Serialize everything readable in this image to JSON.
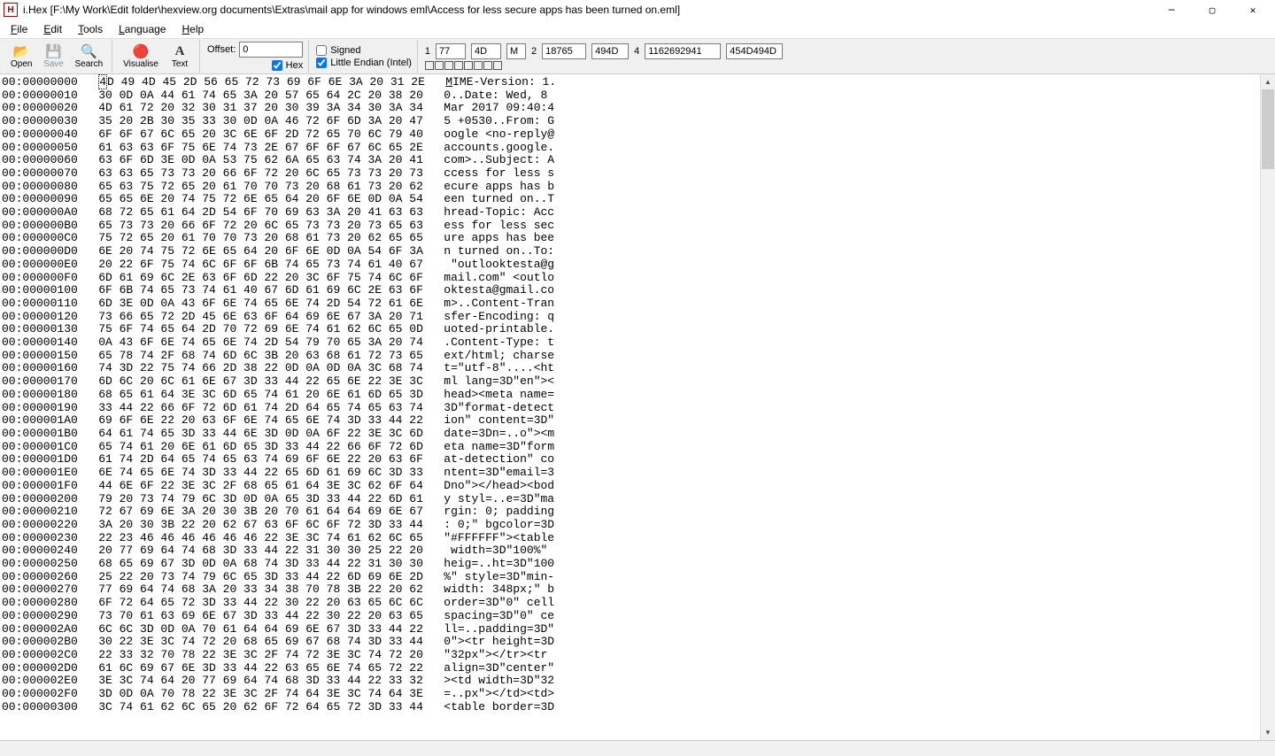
{
  "title": "i.Hex [F:\\My Work\\Edit folder\\hexview.org documents\\Extras\\mail app for windows eml\\Access for less secure apps has been turned on.eml]",
  "app_icon": "H",
  "menu": {
    "file": "File",
    "edit": "Edit",
    "tools": "Tools",
    "language": "Language",
    "help": "Help"
  },
  "toolbar": {
    "open": "Open",
    "save": "Save",
    "search": "Search",
    "visualise": "Visualise",
    "text": "Text",
    "offset_label": "Offset:",
    "offset_value": "0",
    "hex_label": "Hex",
    "signed": "Signed",
    "little_endian": "Little Endian (Intel)",
    "v1_label": "1",
    "v1a": "77",
    "v1b": "4D",
    "v1c": "M",
    "v2_label": "2",
    "v2a": "18765",
    "v2b": "494D",
    "v4_label": "4",
    "v4a": "1162692941",
    "v4b": "454D494D"
  },
  "hex_rows": [
    {
      "o": "00:00000000",
      "h": "4D 49 4D 45 2D 56 65 72 73 69 6F 6E 3A 20 31 2E",
      "a": "MIME-Version: 1."
    },
    {
      "o": "00:00000010",
      "h": "30 0D 0A 44 61 74 65 3A 20 57 65 64 2C 20 38 20",
      "a": "0..Date: Wed, 8 "
    },
    {
      "o": "00:00000020",
      "h": "4D 61 72 20 32 30 31 37 20 30 39 3A 34 30 3A 34",
      "a": "Mar 2017 09:40:4"
    },
    {
      "o": "00:00000030",
      "h": "35 20 2B 30 35 33 30 0D 0A 46 72 6F 6D 3A 20 47",
      "a": "5 +0530..From: G"
    },
    {
      "o": "00:00000040",
      "h": "6F 6F 67 6C 65 20 3C 6E 6F 2D 72 65 70 6C 79 40",
      "a": "oogle <no-reply@"
    },
    {
      "o": "00:00000050",
      "h": "61 63 63 6F 75 6E 74 73 2E 67 6F 6F 67 6C 65 2E",
      "a": "accounts.google."
    },
    {
      "o": "00:00000060",
      "h": "63 6F 6D 3E 0D 0A 53 75 62 6A 65 63 74 3A 20 41",
      "a": "com>..Subject: A"
    },
    {
      "o": "00:00000070",
      "h": "63 63 65 73 73 20 66 6F 72 20 6C 65 73 73 20 73",
      "a": "ccess for less s"
    },
    {
      "o": "00:00000080",
      "h": "65 63 75 72 65 20 61 70 70 73 20 68 61 73 20 62",
      "a": "ecure apps has b"
    },
    {
      "o": "00:00000090",
      "h": "65 65 6E 20 74 75 72 6E 65 64 20 6F 6E 0D 0A 54",
      "a": "een turned on..T"
    },
    {
      "o": "00:000000A0",
      "h": "68 72 65 61 64 2D 54 6F 70 69 63 3A 20 41 63 63",
      "a": "hread-Topic: Acc"
    },
    {
      "o": "00:000000B0",
      "h": "65 73 73 20 66 6F 72 20 6C 65 73 73 20 73 65 63",
      "a": "ess for less sec"
    },
    {
      "o": "00:000000C0",
      "h": "75 72 65 20 61 70 70 73 20 68 61 73 20 62 65 65",
      "a": "ure apps has bee"
    },
    {
      "o": "00:000000D0",
      "h": "6E 20 74 75 72 6E 65 64 20 6F 6E 0D 0A 54 6F 3A",
      "a": "n turned on..To:"
    },
    {
      "o": "00:000000E0",
      "h": "20 22 6F 75 74 6C 6F 6F 6B 74 65 73 74 61 40 67",
      "a": " \"outlooktesta@g"
    },
    {
      "o": "00:000000F0",
      "h": "6D 61 69 6C 2E 63 6F 6D 22 20 3C 6F 75 74 6C 6F",
      "a": "mail.com\" <outlo"
    },
    {
      "o": "00:00000100",
      "h": "6F 6B 74 65 73 74 61 40 67 6D 61 69 6C 2E 63 6F",
      "a": "oktesta@gmail.co"
    },
    {
      "o": "00:00000110",
      "h": "6D 3E 0D 0A 43 6F 6E 74 65 6E 74 2D 54 72 61 6E",
      "a": "m>..Content-Tran"
    },
    {
      "o": "00:00000120",
      "h": "73 66 65 72 2D 45 6E 63 6F 64 69 6E 67 3A 20 71",
      "a": "sfer-Encoding: q"
    },
    {
      "o": "00:00000130",
      "h": "75 6F 74 65 64 2D 70 72 69 6E 74 61 62 6C 65 0D",
      "a": "uoted-printable."
    },
    {
      "o": "00:00000140",
      "h": "0A 43 6F 6E 74 65 6E 74 2D 54 79 70 65 3A 20 74",
      "a": ".Content-Type: t"
    },
    {
      "o": "00:00000150",
      "h": "65 78 74 2F 68 74 6D 6C 3B 20 63 68 61 72 73 65",
      "a": "ext/html; charse"
    },
    {
      "o": "00:00000160",
      "h": "74 3D 22 75 74 66 2D 38 22 0D 0A 0D 0A 3C 68 74",
      "a": "t=\"utf-8\"....<ht"
    },
    {
      "o": "00:00000170",
      "h": "6D 6C 20 6C 61 6E 67 3D 33 44 22 65 6E 22 3E 3C",
      "a": "ml lang=3D\"en\"><"
    },
    {
      "o": "00:00000180",
      "h": "68 65 61 64 3E 3C 6D 65 74 61 20 6E 61 6D 65 3D",
      "a": "head><meta name="
    },
    {
      "o": "00:00000190",
      "h": "33 44 22 66 6F 72 6D 61 74 2D 64 65 74 65 63 74",
      "a": "3D\"format-detect"
    },
    {
      "o": "00:000001A0",
      "h": "69 6F 6E 22 20 63 6F 6E 74 65 6E 74 3D 33 44 22",
      "a": "ion\" content=3D\""
    },
    {
      "o": "00:000001B0",
      "h": "64 61 74 65 3D 33 44 6E 3D 0D 0A 6F 22 3E 3C 6D",
      "a": "date=3Dn=..o\"><m"
    },
    {
      "o": "00:000001C0",
      "h": "65 74 61 20 6E 61 6D 65 3D 33 44 22 66 6F 72 6D",
      "a": "eta name=3D\"form"
    },
    {
      "o": "00:000001D0",
      "h": "61 74 2D 64 65 74 65 63 74 69 6F 6E 22 20 63 6F",
      "a": "at-detection\" co"
    },
    {
      "o": "00:000001E0",
      "h": "6E 74 65 6E 74 3D 33 44 22 65 6D 61 69 6C 3D 33",
      "a": "ntent=3D\"email=3"
    },
    {
      "o": "00:000001F0",
      "h": "44 6E 6F 22 3E 3C 2F 68 65 61 64 3E 3C 62 6F 64",
      "a": "Dno\"></head><bod"
    },
    {
      "o": "00:00000200",
      "h": "79 20 73 74 79 6C 3D 0D 0A 65 3D 33 44 22 6D 61",
      "a": "y styl=..e=3D\"ma"
    },
    {
      "o": "00:00000210",
      "h": "72 67 69 6E 3A 20 30 3B 20 70 61 64 64 69 6E 67",
      "a": "rgin: 0; padding"
    },
    {
      "o": "00:00000220",
      "h": "3A 20 30 3B 22 20 62 67 63 6F 6C 6F 72 3D 33 44",
      "a": ": 0;\" bgcolor=3D"
    },
    {
      "o": "00:00000230",
      "h": "22 23 46 46 46 46 46 46 22 3E 3C 74 61 62 6C 65",
      "a": "\"#FFFFFF\"><table"
    },
    {
      "o": "00:00000240",
      "h": "20 77 69 64 74 68 3D 33 44 22 31 30 30 25 22 20",
      "a": " width=3D\"100%\" "
    },
    {
      "o": "00:00000250",
      "h": "68 65 69 67 3D 0D 0A 68 74 3D 33 44 22 31 30 30",
      "a": "heig=..ht=3D\"100"
    },
    {
      "o": "00:00000260",
      "h": "25 22 20 73 74 79 6C 65 3D 33 44 22 6D 69 6E 2D",
      "a": "%\" style=3D\"min-"
    },
    {
      "o": "00:00000270",
      "h": "77 69 64 74 68 3A 20 33 34 38 70 78 3B 22 20 62",
      "a": "width: 348px;\" b"
    },
    {
      "o": "00:00000280",
      "h": "6F 72 64 65 72 3D 33 44 22 30 22 20 63 65 6C 6C",
      "a": "order=3D\"0\" cell"
    },
    {
      "o": "00:00000290",
      "h": "73 70 61 63 69 6E 67 3D 33 44 22 30 22 20 63 65",
      "a": "spacing=3D\"0\" ce"
    },
    {
      "o": "00:000002A0",
      "h": "6C 6C 3D 0D 0A 70 61 64 64 69 6E 67 3D 33 44 22",
      "a": "ll=..padding=3D\""
    },
    {
      "o": "00:000002B0",
      "h": "30 22 3E 3C 74 72 20 68 65 69 67 68 74 3D 33 44",
      "a": "0\"><tr height=3D"
    },
    {
      "o": "00:000002C0",
      "h": "22 33 32 70 78 22 3E 3C 2F 74 72 3E 3C 74 72 20",
      "a": "\"32px\"></tr><tr "
    },
    {
      "o": "00:000002D0",
      "h": "61 6C 69 67 6E 3D 33 44 22 63 65 6E 74 65 72 22",
      "a": "align=3D\"center\""
    },
    {
      "o": "00:000002E0",
      "h": "3E 3C 74 64 20 77 69 64 74 68 3D 33 44 22 33 32",
      "a": "><td width=3D\"32"
    },
    {
      "o": "00:000002F0",
      "h": "3D 0D 0A 70 78 22 3E 3C 2F 74 64 3E 3C 74 64 3E",
      "a": "=..px\"></td><td>"
    },
    {
      "o": "00:00000300",
      "h": "3C 74 61 62 6C 65 20 62 6F 72 64 65 72 3D 33 44",
      "a": "<table border=3D"
    }
  ]
}
